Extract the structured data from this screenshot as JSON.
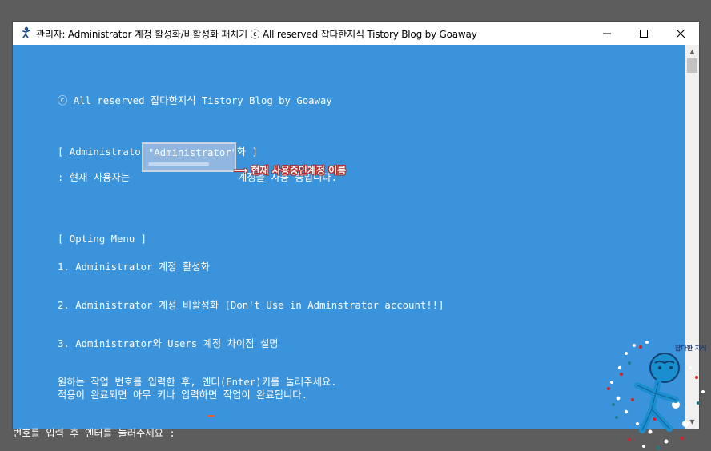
{
  "window": {
    "title": "관리자:  Administrator 계정 활성화/비활성화 패치기 ⓒ All reserved 잡다한지식 Tistory Blog by Goaway",
    "icon": "cmd-icon",
    "controls": {
      "minimize": "—",
      "maximize": "☐",
      "close": "✕"
    }
  },
  "colors": {
    "console_bg": "#3b93dc",
    "console_fg": "#ffffff",
    "annotation": "#b52a25"
  },
  "console": {
    "copyright": "ⓒ All reserved 잡다한지식 Tistory Blog by Goaway",
    "section_header": "[ Administrator 계정 활성화/비활성화 ]",
    "current_user_prefix": ": 현재 사용자는",
    "current_user_value": "\"Administrator\"",
    "current_user_underline": "===============",
    "current_user_suffix": "계정을 사용 중입니다.",
    "menu_header": "[ Opting Menu ]",
    "menu_items": [
      "1. Administrator 계정 활성화",
      "2. Administrator 계정 비활성화 [Don't Use in Adminstrator account!!]",
      "3. Administrator와 Users 계정 차이점 설명"
    ],
    "instruction_1": "원하는 작업 번호를 입력한 후, 엔터(Enter)키를 눌러주세요.",
    "instruction_2": "적용이 완료되면 아무 키나 입력하면 작업이 완료됩니다.",
    "prompt": "번호를 입력 후 엔터를 눌러주세요 :"
  },
  "annotation": {
    "arrow": "⟶",
    "text": "현재 사용중인계정 이름"
  },
  "watermark": {
    "text": "잡다한 지식"
  }
}
